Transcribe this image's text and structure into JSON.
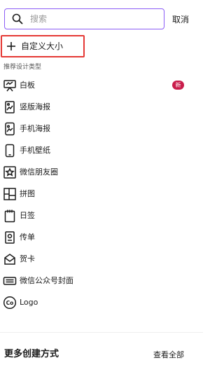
{
  "search": {
    "placeholder": "搜索",
    "cancel_label": "取消"
  },
  "custom_size": {
    "label": "自定义大小"
  },
  "section_title": "推荐设计类型",
  "items": [
    {
      "label": "白板",
      "icon": "whiteboard-icon",
      "badge": "新"
    },
    {
      "label": "竖版海报",
      "icon": "poster-icon"
    },
    {
      "label": "手机海报",
      "icon": "phone-poster-icon"
    },
    {
      "label": "手机壁纸",
      "icon": "phone-wallpaper-icon"
    },
    {
      "label": "微信朋友圈",
      "icon": "wechat-moments-icon"
    },
    {
      "label": "拼图",
      "icon": "collage-icon"
    },
    {
      "label": "日签",
      "icon": "calendar-icon"
    },
    {
      "label": "传单",
      "icon": "flyer-icon"
    },
    {
      "label": "贺卡",
      "icon": "greeting-card-icon"
    },
    {
      "label": "微信公众号封面",
      "icon": "wechat-cover-icon"
    },
    {
      "label": "Logo",
      "icon": "logo-icon"
    }
  ],
  "more": {
    "title": "更多创建方式",
    "view_all_label": "查看全部"
  },
  "colors": {
    "accent_border": "#8b5cf6",
    "highlight": "#e53935",
    "badge": "#c91d4b"
  }
}
